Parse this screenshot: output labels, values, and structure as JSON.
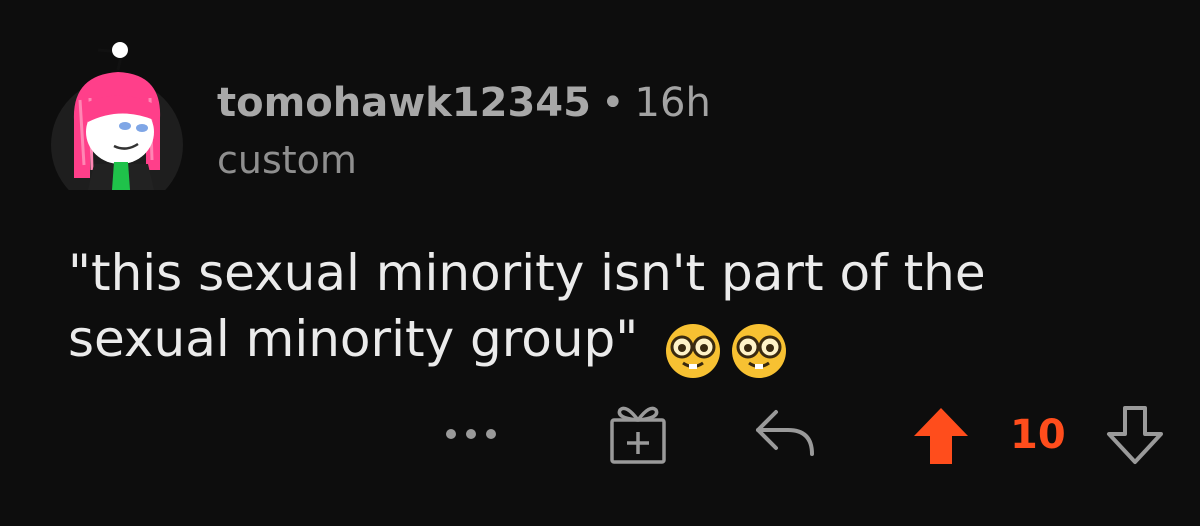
{
  "comment": {
    "username": "tomohawk12345",
    "separator": "•",
    "timestamp": "16h",
    "flair": "custom",
    "body_line1": "\"this sexual minority isn't part of the",
    "body_line2": "sexual minority group\"",
    "emojis": [
      "nerd-face-emoji",
      "nerd-face-emoji"
    ],
    "score": "10",
    "vote_state": "upvoted"
  },
  "colors": {
    "background": "#0d0d0d",
    "upvote_accent": "#ff4d1c",
    "meta_text": "#a3a3a3",
    "body_text": "#ebebeb",
    "icon": "#9a9a9a"
  },
  "icons": {
    "more": "ellipsis-icon",
    "award": "gift-award-icon",
    "reply": "reply-arrow-icon",
    "upvote": "upvote-arrow-icon",
    "downvote": "downvote-arrow-icon"
  }
}
